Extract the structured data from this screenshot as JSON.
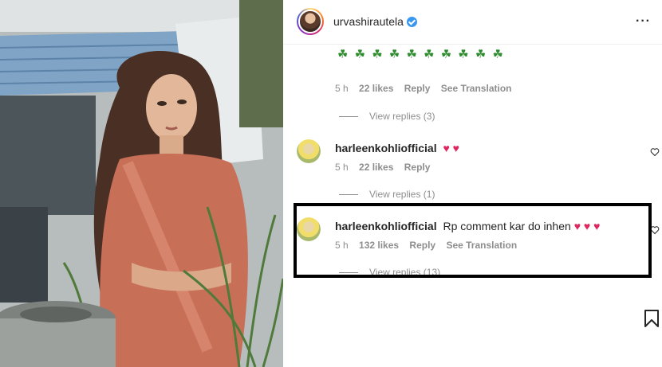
{
  "post": {
    "author": "urvashirautela",
    "caption_emojis": "☘ ☘ ☘ ☘ ☘ ☘ ☘ ☘ ☘ ☘",
    "caption_time": "5 h",
    "caption_likes": "22 likes",
    "caption_reply": "Reply",
    "caption_translate": "See Translation",
    "caption_view_replies": "View replies (3)"
  },
  "comments": [
    {
      "user": "harleenkohliofficial",
      "text": "",
      "hearts": "♥ ♥",
      "time": "5 h",
      "likes": "22 likes",
      "reply": "Reply",
      "view_replies": "View replies (1)"
    },
    {
      "user": "harleenkohliofficial",
      "text": "Rp comment kar do inhen",
      "hearts": "♥ ♥ ♥",
      "time": "5 h",
      "likes": "132 likes",
      "reply": "Reply",
      "translate": "See Translation",
      "view_replies": "View replies (13)"
    }
  ],
  "icons": {
    "more": "more-options-icon",
    "verified": "verified-badge-icon",
    "like": "heart-outline-icon",
    "save": "bookmark-icon"
  },
  "colors": {
    "heart": "#e0245e",
    "verified": "#3897f0",
    "muted": "#8e8e8e",
    "highlight_border": "#000000"
  }
}
